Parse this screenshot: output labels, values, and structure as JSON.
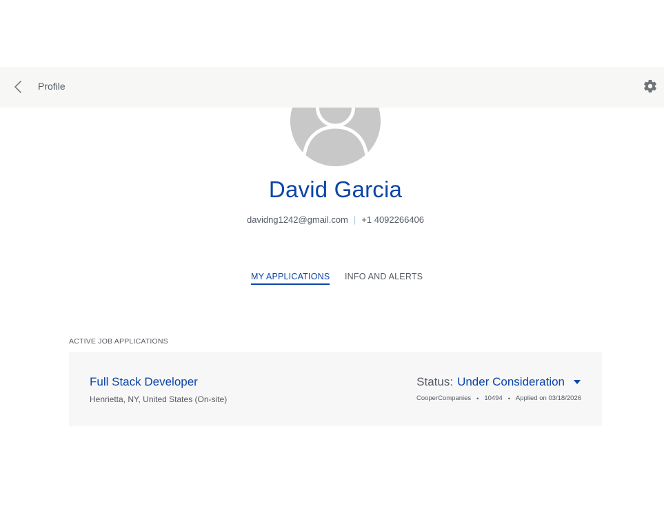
{
  "header": {
    "title": "Profile"
  },
  "profile": {
    "name": "David Garcia",
    "email": "davidng1242@gmail.com",
    "separator": "|",
    "phone": "+1 4092266406"
  },
  "tabs": [
    {
      "label": "MY APPLICATIONS",
      "active": true
    },
    {
      "label": "INFO AND ALERTS",
      "active": false
    }
  ],
  "applications": {
    "section_label": "ACTIVE JOB APPLICATIONS",
    "items": [
      {
        "title": "Full Stack Developer",
        "location": "Henrietta, NY, United States (On-site)",
        "status_label": "Status:",
        "status_value": "Under Consideration",
        "company": "CooperCompanies",
        "job_id": "10494",
        "applied": "Applied on 03/18/2026",
        "dot": "•"
      }
    ]
  },
  "colors": {
    "brand_blue": "#0a45a8",
    "text_gray": "#555b63",
    "header_bg": "#f7f7f5",
    "card_bg": "#f7f7f7",
    "avatar_gray": "#c8c8c8"
  },
  "icons": {
    "back": "chevron-left-icon",
    "settings": "gear-icon",
    "avatar": "user-silhouette-icon",
    "status_toggle": "caret-down-icon"
  }
}
